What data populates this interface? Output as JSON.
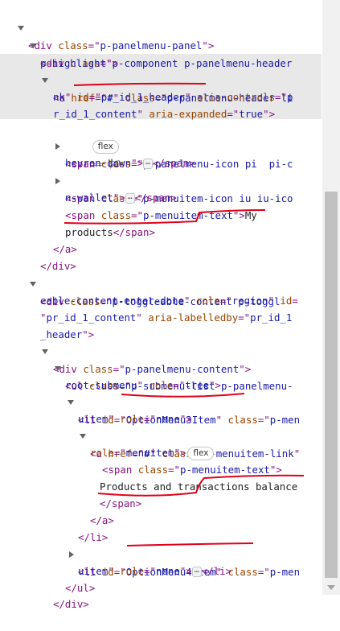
{
  "rows": [
    {
      "id": "r0",
      "parts": [
        [
          "tag",
          "<div "
        ],
        [
          "attr",
          "class"
        ],
        [
          "tag",
          "=\""
        ],
        [
          "val",
          "p-panelmenu-panel"
        ],
        [
          "tag",
          "\">"
        ]
      ]
    },
    {
      "id": "r1",
      "parts": [
        [
          "tag",
          "<div "
        ],
        [
          "attr",
          "class"
        ],
        [
          "tag",
          "=\""
        ],
        [
          "val",
          "p-component p-panelmenu-header"
        ]
      ]
    },
    {
      "id": "r2",
      "parts": [
        [
          "val",
          "p-highlight"
        ],
        [
          "tag",
          "\">"
        ]
      ]
    },
    {
      "id": "r3",
      "parts": [
        [
          "tag",
          "<a "
        ],
        [
          "attr",
          "href"
        ],
        [
          "tag",
          "=\""
        ],
        [
          "val",
          "#"
        ],
        [
          "tag",
          "\" "
        ],
        [
          "attr",
          "class"
        ],
        [
          "tag",
          "=\""
        ],
        [
          "val",
          "p-panelmenu-header-li"
        ]
      ]
    },
    {
      "id": "r4",
      "parts": [
        [
          "val",
          "nk"
        ],
        [
          "tag",
          "\" "
        ],
        [
          "attr",
          "id"
        ],
        [
          "tag",
          "=\""
        ],
        [
          "val",
          "pr_id_1_header"
        ],
        [
          "tag",
          "\" "
        ],
        [
          "attr",
          "aria-controls"
        ],
        [
          "tag",
          "=\""
        ],
        [
          "val",
          "p"
        ]
      ]
    },
    {
      "id": "r5",
      "parts": [
        [
          "val",
          "r_id_1_content"
        ],
        [
          "tag",
          "\" "
        ],
        [
          "attr",
          "aria-expanded"
        ],
        [
          "tag",
          "=\""
        ],
        [
          "val",
          "true"
        ],
        [
          "tag",
          "\">"
        ]
      ]
    },
    {
      "id": "r6",
      "parts": []
    },
    {
      "id": "r7",
      "parts": [
        [
          "tag",
          "<span "
        ],
        [
          "attr",
          "class"
        ],
        [
          "tag",
          "=\""
        ],
        [
          "val",
          "p-panelmenu-icon pi  pi-c"
        ]
      ]
    },
    {
      "id": "r8",
      "parts": [
        [
          "val",
          "hevron-down"
        ],
        [
          "tag",
          "\">"
        ]
      ]
    },
    {
      "id": "r9",
      "parts": [
        [
          "tag",
          "<span "
        ],
        [
          "attr",
          "class"
        ],
        [
          "tag",
          "=\""
        ],
        [
          "val",
          "p-menuitem-icon iu iu-ico"
        ]
      ]
    },
    {
      "id": "r10",
      "parts": [
        [
          "val",
          "n-wallet"
        ],
        [
          "tag",
          "\">"
        ]
      ]
    },
    {
      "id": "r11",
      "parts": [
        [
          "tag",
          "<span "
        ],
        [
          "attr",
          "class"
        ],
        [
          "tag",
          "=\""
        ],
        [
          "val",
          "p-menuitem-text"
        ],
        [
          "tag",
          "\">"
        ],
        [
          "txt",
          "My"
        ]
      ]
    },
    {
      "id": "r12",
      "parts": [
        [
          "txt",
          "products"
        ],
        [
          "tag",
          "</span>"
        ]
      ]
    },
    {
      "id": "r13",
      "parts": [
        [
          "tag",
          "</a>"
        ]
      ]
    },
    {
      "id": "r14",
      "parts": [
        [
          "tag",
          "</div>"
        ]
      ]
    },
    {
      "id": "r15",
      "parts": [
        [
          "tag",
          "<div "
        ],
        [
          "attr",
          "class"
        ],
        [
          "tag",
          "=\""
        ],
        [
          "val",
          "p-toggleable-content p-toggl"
        ]
      ]
    },
    {
      "id": "r16",
      "parts": [
        [
          "val",
          "eable-content-enter-done"
        ],
        [
          "tag",
          "\" "
        ],
        [
          "attr",
          "role"
        ],
        [
          "tag",
          "=\""
        ],
        [
          "val",
          "region"
        ],
        [
          "tag",
          "\" "
        ],
        [
          "attr",
          "id"
        ],
        [
          "tag",
          "="
        ]
      ]
    },
    {
      "id": "r17",
      "parts": [
        [
          "tag",
          "\""
        ],
        [
          "val",
          "pr_id_1_content"
        ],
        [
          "tag",
          "\" "
        ],
        [
          "attr",
          "aria-labelledby"
        ],
        [
          "tag",
          "=\""
        ],
        [
          "val",
          "pr_id_1"
        ]
      ]
    },
    {
      "id": "r18",
      "parts": [
        [
          "val",
          "_header"
        ],
        [
          "tag",
          "\">"
        ]
      ]
    },
    {
      "id": "r19",
      "parts": [
        [
          "tag",
          "<div "
        ],
        [
          "attr",
          "class"
        ],
        [
          "tag",
          "=\""
        ],
        [
          "val",
          "p-panelmenu-content"
        ],
        [
          "tag",
          "\">"
        ]
      ]
    },
    {
      "id": "r20",
      "parts": [
        [
          "tag",
          "<ul "
        ],
        [
          "attr",
          "class"
        ],
        [
          "tag",
          "=\""
        ],
        [
          "val",
          "p-submenu-list p-panelmenu-"
        ]
      ]
    },
    {
      "id": "r21",
      "parts": [
        [
          "val",
          "root-submenu"
        ],
        [
          "tag",
          "\" "
        ],
        [
          "attr",
          "role"
        ],
        [
          "tag",
          "=\""
        ],
        [
          "val",
          "tree"
        ],
        [
          "tag",
          "\">"
        ]
      ]
    },
    {
      "id": "r22",
      "parts": [
        [
          "tag",
          "<li "
        ],
        [
          "attr",
          "id"
        ],
        [
          "tag",
          "=\""
        ],
        [
          "val",
          "OptionMenu3Item"
        ],
        [
          "tag",
          "\" "
        ],
        [
          "attr",
          "class"
        ],
        [
          "tag",
          "=\""
        ],
        [
          "val",
          "p-men"
        ]
      ]
    },
    {
      "id": "r23",
      "parts": [
        [
          "val",
          "uitem"
        ],
        [
          "tag",
          "\" "
        ],
        [
          "attr",
          "role"
        ],
        [
          "tag",
          "=\""
        ],
        [
          "val",
          "none"
        ],
        [
          "tag",
          "\">"
        ]
      ]
    },
    {
      "id": "r24",
      "parts": [
        [
          "tag",
          "<a "
        ],
        [
          "attr",
          "href"
        ],
        [
          "tag",
          "=\""
        ],
        [
          "val",
          "#"
        ],
        [
          "tag",
          "\" "
        ],
        [
          "attr",
          "class"
        ],
        [
          "tag",
          "=\""
        ],
        [
          "val",
          "p-menuitem-link"
        ],
        [
          "tag",
          "\""
        ]
      ]
    },
    {
      "id": "r25",
      "parts": [
        [
          "attr",
          "role"
        ],
        [
          "tag",
          "=\""
        ],
        [
          "val",
          "menuitem"
        ],
        [
          "tag",
          "\">"
        ]
      ]
    },
    {
      "id": "r26",
      "parts": [
        [
          "tag",
          "<span "
        ],
        [
          "attr",
          "class"
        ],
        [
          "tag",
          "=\""
        ],
        [
          "val",
          "p-menuitem-text"
        ],
        [
          "tag",
          "\">"
        ]
      ]
    },
    {
      "id": "r27",
      "parts": [
        [
          "txt",
          "Products and transactions balance"
        ]
      ]
    },
    {
      "id": "r28",
      "parts": [
        [
          "tag",
          "</span>"
        ]
      ]
    },
    {
      "id": "r29",
      "parts": [
        [
          "tag",
          "</a>"
        ]
      ]
    },
    {
      "id": "r30",
      "parts": [
        [
          "tag",
          "</li>"
        ]
      ]
    },
    {
      "id": "r31",
      "parts": [
        [
          "tag",
          "<li "
        ],
        [
          "attr",
          "id"
        ],
        [
          "tag",
          "=\""
        ],
        [
          "val",
          "OptionMenu4Item"
        ],
        [
          "tag",
          "\" "
        ],
        [
          "attr",
          "class"
        ],
        [
          "tag",
          "=\""
        ],
        [
          "val",
          "p-men"
        ]
      ]
    },
    {
      "id": "r32",
      "parts": [
        [
          "val",
          "uitem"
        ],
        [
          "tag",
          "\" "
        ],
        [
          "attr",
          "role"
        ],
        [
          "tag",
          "=\""
        ],
        [
          "val",
          "none"
        ],
        [
          "tag",
          "\">"
        ]
      ]
    },
    {
      "id": "r33",
      "parts": [
        [
          "tag",
          "</ul>"
        ]
      ]
    },
    {
      "id": "r34",
      "parts": [
        [
          "tag",
          "</div>"
        ]
      ]
    }
  ],
  "badges": {
    "flex": "flex",
    "eq": "== $0"
  },
  "ellipsis": "…",
  "closing": {
    "span": "</span>",
    "li": "</li>"
  }
}
